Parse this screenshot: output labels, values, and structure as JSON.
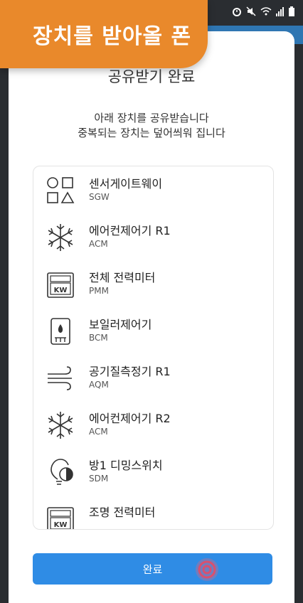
{
  "badge": {
    "label": "장치를 받아올 폰"
  },
  "status_bar": {
    "icons": [
      "alarm-icon",
      "mute-icon",
      "wifi-icon",
      "signal-icon",
      "battery-icon"
    ]
  },
  "title": "공유받기 완료",
  "description": [
    "아래 장치를 공유받습니다",
    "중복되는 장치는 덮어씌워 집니다"
  ],
  "devices": [
    {
      "name": "센서게이트웨이",
      "code": "SGW",
      "icon": "shapes-icon"
    },
    {
      "name": "에어컨제어기 R1",
      "code": "ACM",
      "icon": "snowflake-icon"
    },
    {
      "name": "전체 전력미터",
      "code": "PMM",
      "icon": "kw-meter-icon"
    },
    {
      "name": "보일러제어기",
      "code": "BCM",
      "icon": "boiler-icon"
    },
    {
      "name": "공기질측정기 R1",
      "code": "AQM",
      "icon": "wind-icon"
    },
    {
      "name": "에어컨제어기 R2",
      "code": "ACM",
      "icon": "snowflake-icon"
    },
    {
      "name": "방1 디밍스위치",
      "code": "SDM",
      "icon": "bulb-icon"
    },
    {
      "name": "조명 전력미터",
      "code": "",
      "icon": "kw-meter-icon"
    }
  ],
  "done_button": {
    "label": "완료"
  },
  "colors": {
    "accent": "#2f8ce5",
    "badge": "#e9892b",
    "text": "#333333"
  }
}
